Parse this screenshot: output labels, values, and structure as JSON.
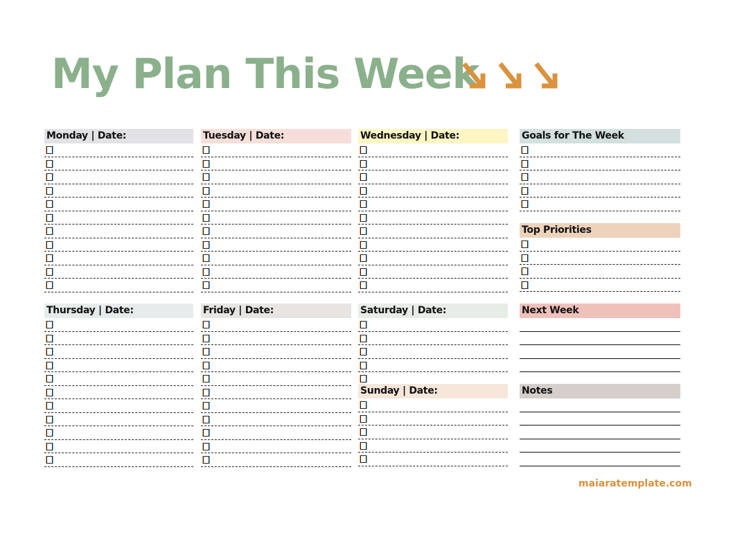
{
  "title": "My Plan This Week",
  "title_icon": "arrow-down-right-icon",
  "colors": {
    "title": "#8bb08c",
    "arrows": "#d9923e",
    "footer": "#d9923e"
  },
  "days": [
    {
      "label": "Monday | Date:",
      "color": "#e1e1e6",
      "rows": 11
    },
    {
      "label": "Tuesday | Date:",
      "color": "#f6dfdb",
      "rows": 11
    },
    {
      "label": "Wednesday | Date:",
      "color": "#fdf6c4",
      "rows": 11
    },
    {
      "label": "Thursday | Date:",
      "color": "#e6eceb",
      "rows": 11
    },
    {
      "label": "Friday | Date:",
      "color": "#e8e4e2",
      "rows": 11
    },
    {
      "label": "Saturday | Date:",
      "color": "#e7ede6",
      "rows": 5
    },
    {
      "label": "Sunday | Date:",
      "color": "#f6e7da",
      "rows": 5
    }
  ],
  "side": {
    "goals": {
      "label": "Goals for The Week",
      "color": "#d3e0df",
      "rows": 5
    },
    "priorities": {
      "label": "Top Priorities",
      "color": "#edd3bb",
      "rows": 4
    },
    "next_week": {
      "label": "Next Week",
      "color": "#efc1bb",
      "lines": 4
    },
    "notes": {
      "label": "Notes",
      "color": "#d5ceca",
      "lines": 5
    }
  },
  "footer": "maiaratemplate.com"
}
